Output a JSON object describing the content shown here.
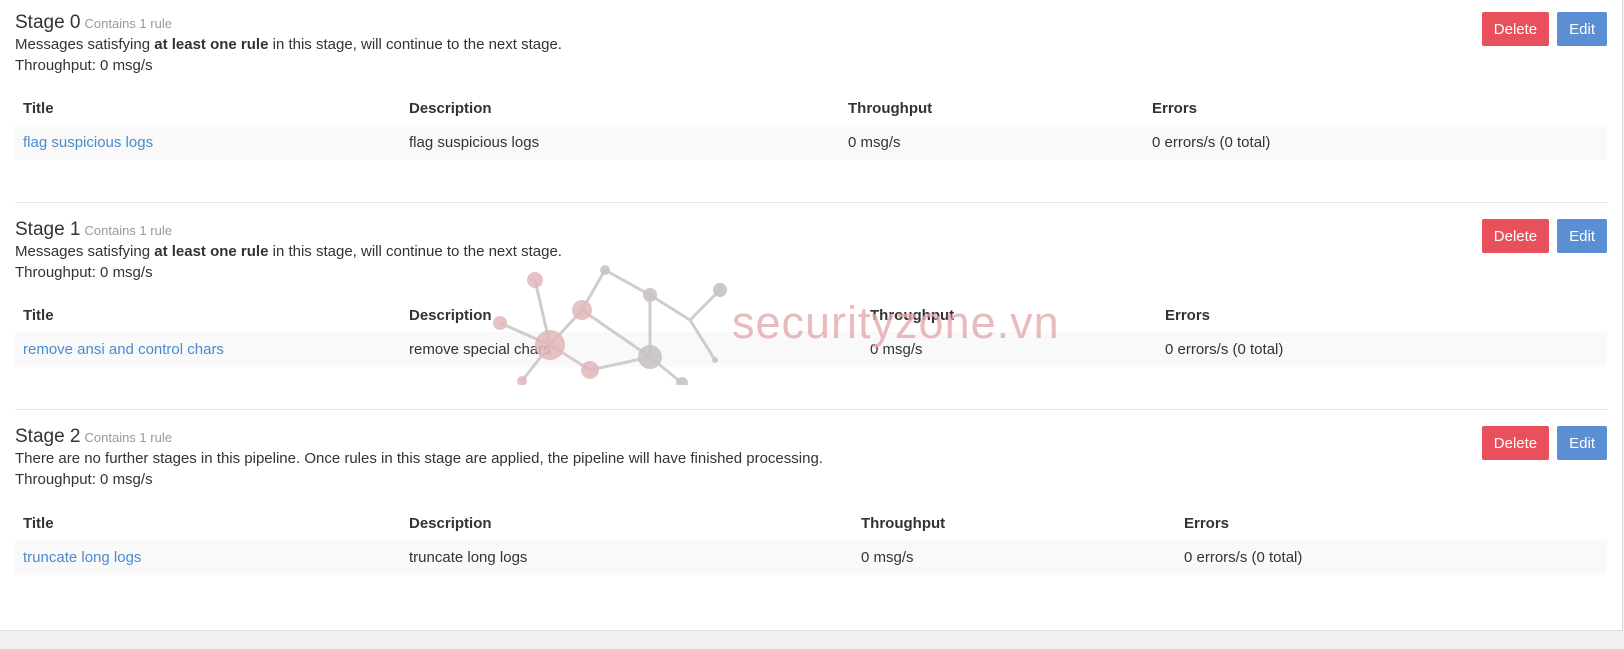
{
  "stages": [
    {
      "title": "Stage 0",
      "rule_count": "Contains 1 rule",
      "desc_pre": "Messages satisfying ",
      "desc_bold": "at least one rule",
      "desc_post": " in this stage, will continue to the next stage.",
      "throughput": "Throughput: 0 msg/s",
      "delete_label": "Delete",
      "edit_label": "Edit",
      "columns": [
        "Title",
        "Description",
        "Throughput",
        "Errors"
      ],
      "rules": [
        {
          "title": "flag suspicious logs",
          "description": "flag suspicious logs",
          "throughput": "0 msg/s",
          "errors": "0 errors/s (0 total)"
        }
      ]
    },
    {
      "title": "Stage 1",
      "rule_count": "Contains 1 rule",
      "desc_pre": "Messages satisfying ",
      "desc_bold": "at least one rule",
      "desc_post": " in this stage, will continue to the next stage.",
      "throughput": "Throughput: 0 msg/s",
      "delete_label": "Delete",
      "edit_label": "Edit",
      "columns": [
        "Title",
        "Description",
        "Throughput",
        "Errors"
      ],
      "rules": [
        {
          "title": "remove ansi and control chars",
          "description": "remove special chars",
          "throughput": "0 msg/s",
          "errors": "0 errors/s (0 total)"
        }
      ]
    },
    {
      "title": "Stage 2",
      "rule_count": "Contains 1 rule",
      "desc_text": "There are no further stages in this pipeline. Once rules in this stage are applied, the pipeline will have finished processing.",
      "throughput": "Throughput: 0 msg/s",
      "delete_label": "Delete",
      "edit_label": "Edit",
      "columns": [
        "Title",
        "Description",
        "Throughput",
        "Errors"
      ],
      "rules": [
        {
          "title": "truncate long logs",
          "description": "truncate long logs",
          "throughput": "0 msg/s",
          "errors": "0 errors/s (0 total)"
        }
      ]
    }
  ],
  "watermark": {
    "text": "securityzone.vn"
  },
  "colors": {
    "delete": "#e8505b",
    "edit": "#5b8fd4",
    "link": "#4a8bd0",
    "watermark": "#e4a9ae"
  }
}
